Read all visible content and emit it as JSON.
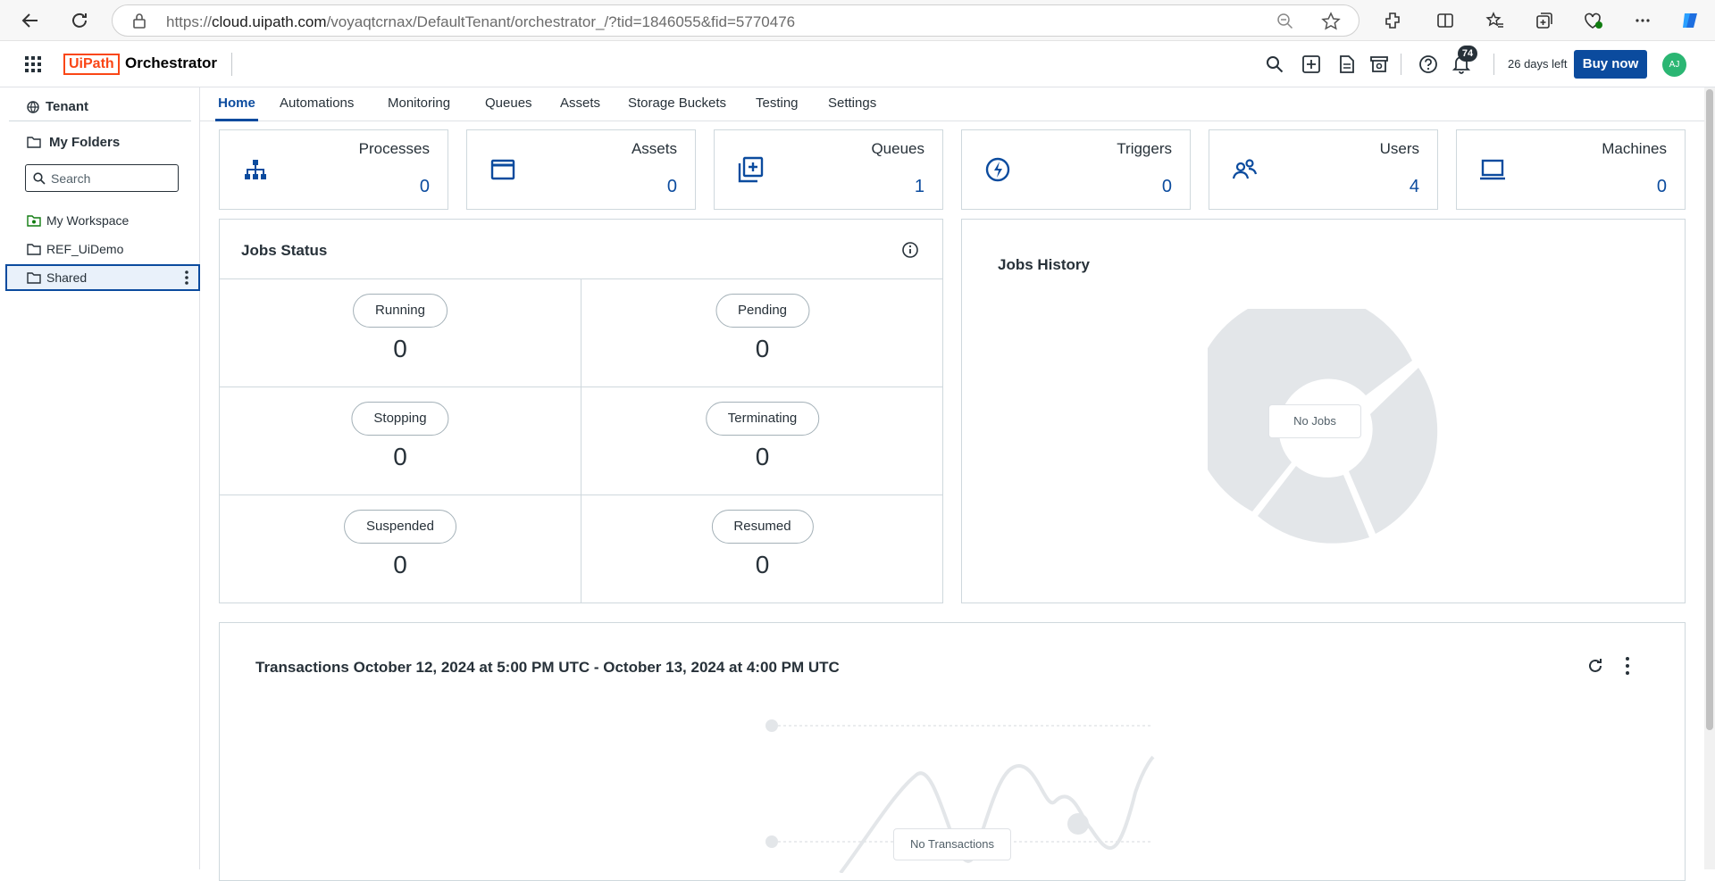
{
  "browser": {
    "url_prefix": "https://",
    "url_host": "cloud.uipath.com",
    "url_path": "/voyaqtcrnax/DefaultTenant/orchestrator_/?tid=1846055&fid=5770476"
  },
  "header": {
    "brand_logo": "UiPath",
    "product": "Orchestrator",
    "notification_count": "74",
    "days_left": "26 days left",
    "buy_now": "Buy now",
    "avatar_initials": "AJ"
  },
  "sidebar": {
    "tenant": "Tenant",
    "folders_title": "My Folders",
    "search_placeholder": "Search",
    "folders": [
      {
        "label": "My Workspace"
      },
      {
        "label": "REF_UiDemo"
      },
      {
        "label": "Shared"
      }
    ]
  },
  "tabs": [
    "Home",
    "Automations",
    "Monitoring",
    "Queues",
    "Assets",
    "Storage Buckets",
    "Testing",
    "Settings"
  ],
  "cards": [
    {
      "title": "Processes",
      "value": "0",
      "icon": "process-icon"
    },
    {
      "title": "Assets",
      "value": "0",
      "icon": "asset-icon"
    },
    {
      "title": "Queues",
      "value": "1",
      "icon": "queue-icon"
    },
    {
      "title": "Triggers",
      "value": "0",
      "icon": "trigger-icon"
    },
    {
      "title": "Users",
      "value": "4",
      "icon": "users-icon"
    },
    {
      "title": "Machines",
      "value": "0",
      "icon": "machine-icon"
    }
  ],
  "jobs_status": {
    "title": "Jobs Status",
    "states": [
      {
        "label": "Running",
        "value": "0"
      },
      {
        "label": "Pending",
        "value": "0"
      },
      {
        "label": "Stopping",
        "value": "0"
      },
      {
        "label": "Terminating",
        "value": "0"
      },
      {
        "label": "Suspended",
        "value": "0"
      },
      {
        "label": "Resumed",
        "value": "0"
      }
    ]
  },
  "jobs_history": {
    "title": "Jobs History",
    "empty_label": "No Jobs"
  },
  "transactions": {
    "title": "Transactions October 12, 2024 at 5:00 PM UTC - October 13, 2024 at 4:00 PM UTC",
    "empty_label": "No Transactions"
  },
  "colors": {
    "accent": "#0b4b9e",
    "brand": "#fa4616"
  }
}
